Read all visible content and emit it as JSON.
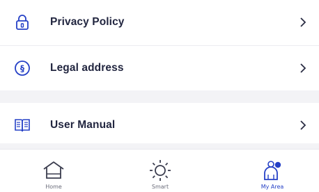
{
  "menu": {
    "items": [
      {
        "label": "Privacy Policy",
        "icon": "lock-icon"
      },
      {
        "label": "Legal address",
        "icon": "section-sign-icon"
      },
      {
        "label": "User Manual",
        "icon": "book-icon"
      }
    ]
  },
  "tabbar": {
    "tabs": [
      {
        "label": "Home",
        "icon": "home-icon",
        "active": false
      },
      {
        "label": "Smart",
        "icon": "sun-icon",
        "active": false
      },
      {
        "label": "My Area",
        "icon": "user-area-icon",
        "active": true
      }
    ]
  },
  "colors": {
    "accent": "#2540c6",
    "text": "#222640",
    "divider": "#f3f3f6"
  }
}
